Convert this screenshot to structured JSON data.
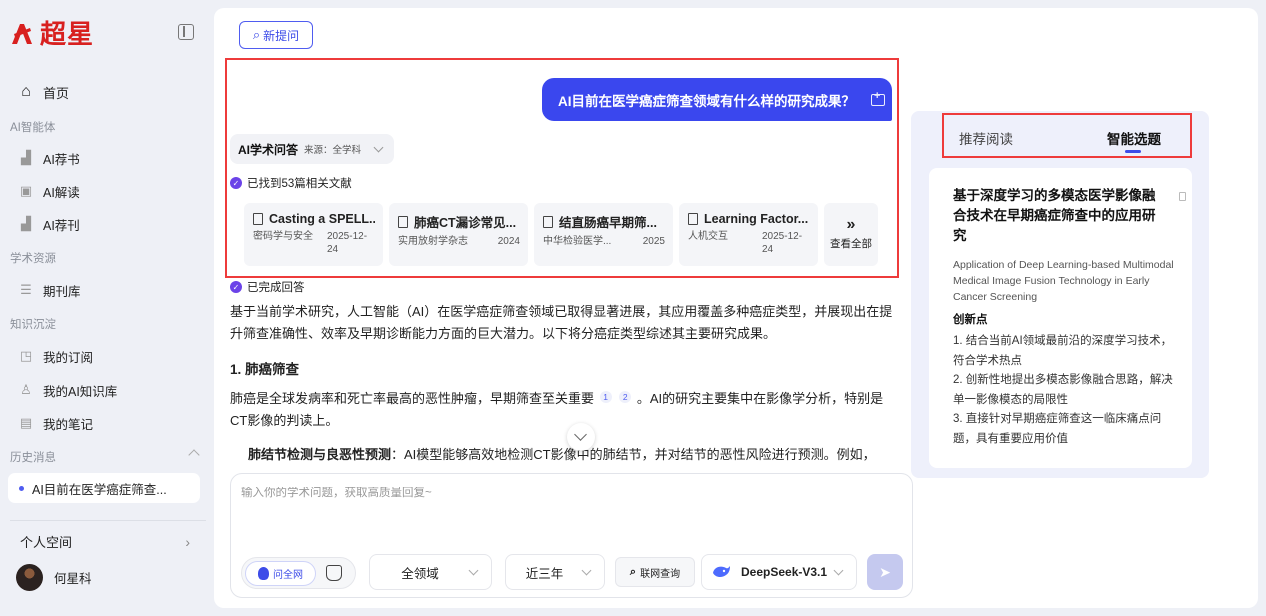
{
  "sidebar": {
    "logo": "超星",
    "home": "首页",
    "sections": {
      "ai_tools": "AI智能体",
      "resources": "学术资源",
      "knowledge": "知识沉淀",
      "history": "历史消息"
    },
    "items": {
      "ai_book": "AI荐书",
      "ai_read": "AI解读",
      "ai_journal": "AI荐刊",
      "journal_db": "期刊库",
      "subscriptions": "我的订阅",
      "ai_kb": "我的AI知识库",
      "notes": "我的笔记"
    },
    "history_item": "AI目前在医学癌症筛查...",
    "personal_space": "个人空间",
    "user_name": "何星科"
  },
  "main": {
    "new_question": "新提问",
    "user_question": "AI目前在医学癌症筛查领域有什么样的研究成果？",
    "ai_tag": {
      "title": "AI学术问答",
      "source": "来源：全学科"
    },
    "found_refs": "已找到53篇相关文献",
    "refs": [
      {
        "title": "Casting a SPELL...",
        "journal": "密码学与安全",
        "date": "2025-12-24"
      },
      {
        "title": "肺癌CT漏诊常见...",
        "journal": "实用放射学杂志",
        "date": "2024"
      },
      {
        "title": "结直肠癌早期筛...",
        "journal": "中华检验医学...",
        "date": "2025"
      },
      {
        "title": "Learning Factor...",
        "journal": "人机交互",
        "date": "2025-12-24"
      }
    ],
    "see_all": "查看全部",
    "done": "已完成回答",
    "para1": "基于当前学术研究，人工智能（AI）在医学癌症筛查领域已取得显著进展，其应用覆盖多种癌症类型，并展现出在提升筛查准确性、效率及早期诊断能力方面的巨大潜力。以下将分癌症类型综述其主要研究成果。",
    "heading1": "1. 肺癌筛查",
    "para2_a": "肺癌是全球发病率和死亡率最高的恶性肿瘤，早期筛查至关重要",
    "cite1": "1",
    "cite2": "2",
    "para2_b": "。AI的研究主要集中在影像学分析，特别是CT影像的判读上。",
    "bullet_bold": "肺结节检测与良恶性预测",
    "bullet_text": "：AI模型能够高效地检测CT影像中的肺结节，并对结节的恶性风险进行预测。例如，DGSAN"
  },
  "input": {
    "placeholder": "输入你的学术问题，获取高质量回复~",
    "mode_active": "问全网",
    "domain": "全领域",
    "period": "近三年",
    "web_search": "联网查询",
    "model": "DeepSeek-V3.1"
  },
  "right": {
    "tab_recommend": "推荐阅读",
    "tab_smart": "智能选题",
    "card": {
      "title": "基于深度学习的多模态医学影像融合技术在早期癌症筛查中的应用研究",
      "title_en": "Application of Deep Learning-based Multimodal Medical Image Fusion Technology in Early Cancer Screening",
      "innovation": "创新点",
      "points": [
        "1. 结合当前AI领域最前沿的深度学习技术，符合学术热点",
        "2. 创新性地提出多模态影像融合思路，解决单一影像模态的局限性",
        "3. 直接针对早期癌症筛查这一临床痛点问题，具有重要应用价值"
      ]
    }
  },
  "colors": {
    "accent": "#3a47ee",
    "highlight": "#ee3b3b",
    "brand": "#d8201f"
  }
}
